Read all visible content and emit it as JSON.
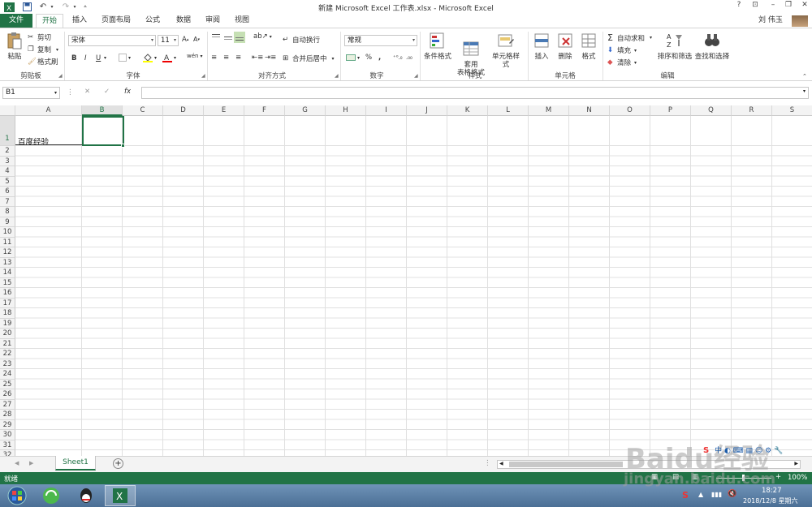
{
  "window": {
    "title": "新建 Microsoft Excel 工作表.xlsx - Microsoft Excel",
    "help": "?",
    "user": "刘 伟玉"
  },
  "tabs": [
    {
      "label": "文件"
    },
    {
      "label": "开始"
    },
    {
      "label": "插入"
    },
    {
      "label": "页面布局"
    },
    {
      "label": "公式"
    },
    {
      "label": "数据"
    },
    {
      "label": "审阅"
    },
    {
      "label": "视图"
    }
  ],
  "ribbon": {
    "clipboard": {
      "paste": "粘贴",
      "cut": "剪切",
      "copy": "复制",
      "format_painter": "格式刷",
      "label": "剪贴板"
    },
    "font": {
      "name": "宋体",
      "size": "11",
      "bold": "B",
      "italic": "I",
      "underline": "U",
      "label": "字体"
    },
    "alignment": {
      "wrap": "自动换行",
      "merge": "合并后居中",
      "label": "对齐方式"
    },
    "number": {
      "format": "常规",
      "percent": "%",
      "comma": ",",
      "label": "数字"
    },
    "styles": {
      "conditional": "条件格式",
      "table": "套用\n表格格式",
      "cell_styles": "单元格样式",
      "label": "样式"
    },
    "cells": {
      "insert": "插入",
      "delete": "删除",
      "format": "格式",
      "label": "单元格"
    },
    "editing": {
      "autosum": "自动求和",
      "fill": "填充",
      "clear": "清除",
      "sort": "排序和筛选",
      "find": "查找和选择",
      "label": "编辑"
    }
  },
  "formula_bar": {
    "name_box": "B1",
    "fx": "fx",
    "value": ""
  },
  "columns": [
    "A",
    "B",
    "C",
    "D",
    "E",
    "F",
    "G",
    "H",
    "I",
    "J",
    "K",
    "L",
    "M",
    "N",
    "O",
    "P",
    "Q",
    "R",
    "S"
  ],
  "rows": [
    "1",
    "2",
    "3",
    "4",
    "5",
    "6",
    "7",
    "8",
    "9",
    "10",
    "11",
    "12",
    "13",
    "14",
    "15",
    "16",
    "17",
    "18",
    "19",
    "20",
    "21",
    "22",
    "23",
    "24",
    "25",
    "26",
    "27",
    "28",
    "29",
    "30",
    "31",
    "32"
  ],
  "cells": {
    "A1": "百度经验"
  },
  "selected_cell": "B1",
  "sheets": [
    "Sheet1"
  ],
  "status": {
    "ready": "就绪",
    "zoom": "100%"
  },
  "taskbar": {
    "time": "18:27",
    "date": "2018/12/8 星期六"
  },
  "watermark": {
    "logo": "Baidu经验",
    "url": "jingyan.baidu.com"
  },
  "colors": {
    "excel_green": "#217346",
    "selection": "#217346"
  }
}
